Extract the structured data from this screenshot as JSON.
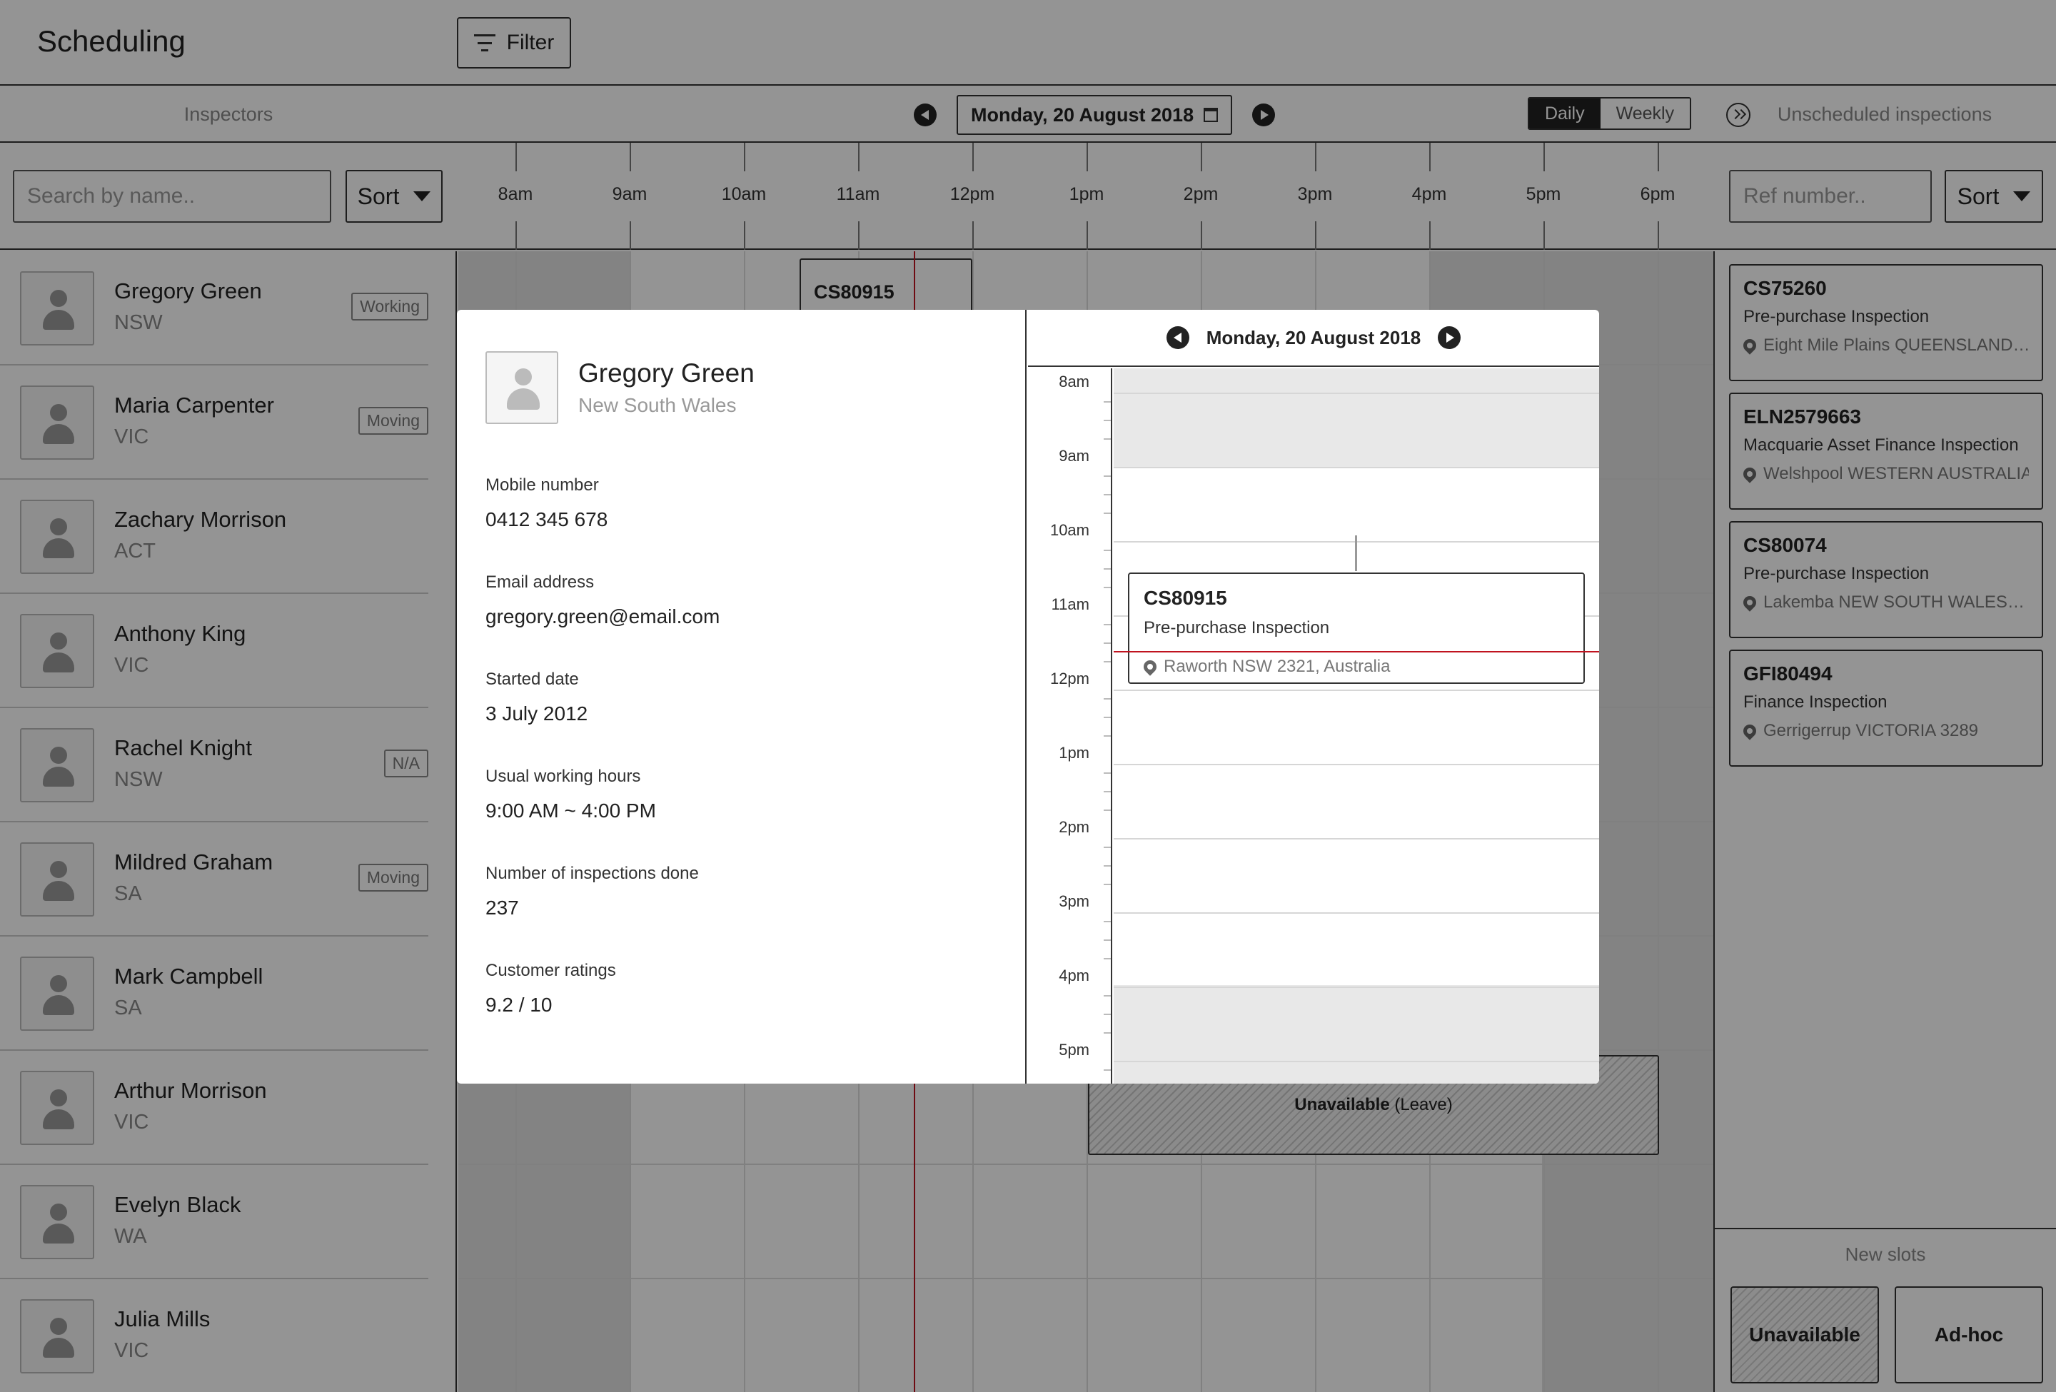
{
  "app": {
    "title": "Scheduling",
    "filter_label": "Filter"
  },
  "header": {
    "inspectors_label": "Inspectors",
    "date": "Monday, 20 August 2018",
    "view_daily": "Daily",
    "view_weekly": "Weekly",
    "unscheduled_label": "Unscheduled inspections"
  },
  "controls": {
    "search_placeholder": "Search by name..",
    "sort_label": "Sort",
    "ref_placeholder": "Ref number..",
    "ref_sort_label": "Sort"
  },
  "timeline": {
    "hours": [
      "8am",
      "9am",
      "10am",
      "11am",
      "12pm",
      "1pm",
      "2pm",
      "3pm",
      "4pm",
      "5pm",
      "6pm"
    ],
    "job_ref": "CS80915",
    "unavailable_bold": "Unavailable",
    "unavailable_reason": "(Leave)"
  },
  "inspectors": [
    {
      "name": "Gregory Green",
      "state": "NSW",
      "badge": "Working"
    },
    {
      "name": "Maria Carpenter",
      "state": "VIC",
      "badge": "Moving"
    },
    {
      "name": "Zachary Morrison",
      "state": "ACT",
      "badge": ""
    },
    {
      "name": "Anthony King",
      "state": "VIC",
      "badge": ""
    },
    {
      "name": "Rachel Knight",
      "state": "NSW",
      "badge": "N/A"
    },
    {
      "name": "Mildred Graham",
      "state": "SA",
      "badge": "Moving"
    },
    {
      "name": "Mark Campbell",
      "state": "SA",
      "badge": ""
    },
    {
      "name": "Arthur Morrison",
      "state": "VIC",
      "badge": ""
    },
    {
      "name": "Evelyn Black",
      "state": "WA",
      "badge": ""
    },
    {
      "name": "Julia Mills",
      "state": "VIC",
      "badge": ""
    }
  ],
  "unscheduled": [
    {
      "ref": "CS75260",
      "type": "Pre-purchase Inspection",
      "location": "Eight Mile Plains QUEENSLAND…"
    },
    {
      "ref": "ELN2579663",
      "type": "Macquarie Asset Finance Inspection",
      "location": "Welshpool WESTERN AUSTRALIA"
    },
    {
      "ref": "CS80074",
      "type": "Pre-purchase Inspection",
      "location": "Lakemba NEW SOUTH WALES…"
    },
    {
      "ref": "GFI80494",
      "type": "Finance Inspection",
      "location": "Gerrigerrup VICTORIA 3289"
    }
  ],
  "new_slots": {
    "label": "New slots",
    "unavailable": "Unavailable",
    "adhoc": "Ad-hoc"
  },
  "modal": {
    "name": "Gregory Green",
    "region": "New South Wales",
    "fields": [
      {
        "label": "Mobile number",
        "value": "0412 345 678"
      },
      {
        "label": "Email address",
        "value": "gregory.green@email.com"
      },
      {
        "label": "Started date",
        "value": "3 July 2012"
      },
      {
        "label": "Usual working hours",
        "value": "9:00 AM ~ 4:00 PM"
      },
      {
        "label": "Number of inspections done",
        "value": "237"
      },
      {
        "label": "Customer ratings",
        "value": "9.2",
        "suffix": " / 10"
      }
    ],
    "calendar": {
      "date": "Monday, 20 August 2018",
      "hours": [
        "8am",
        "9am",
        "10am",
        "11am",
        "12pm",
        "1pm",
        "2pm",
        "3pm",
        "4pm",
        "5pm"
      ],
      "event": {
        "ref": "CS80915",
        "type": "Pre-purchase Inspection",
        "location": "Raworth NSW 2321, Australia"
      }
    }
  }
}
